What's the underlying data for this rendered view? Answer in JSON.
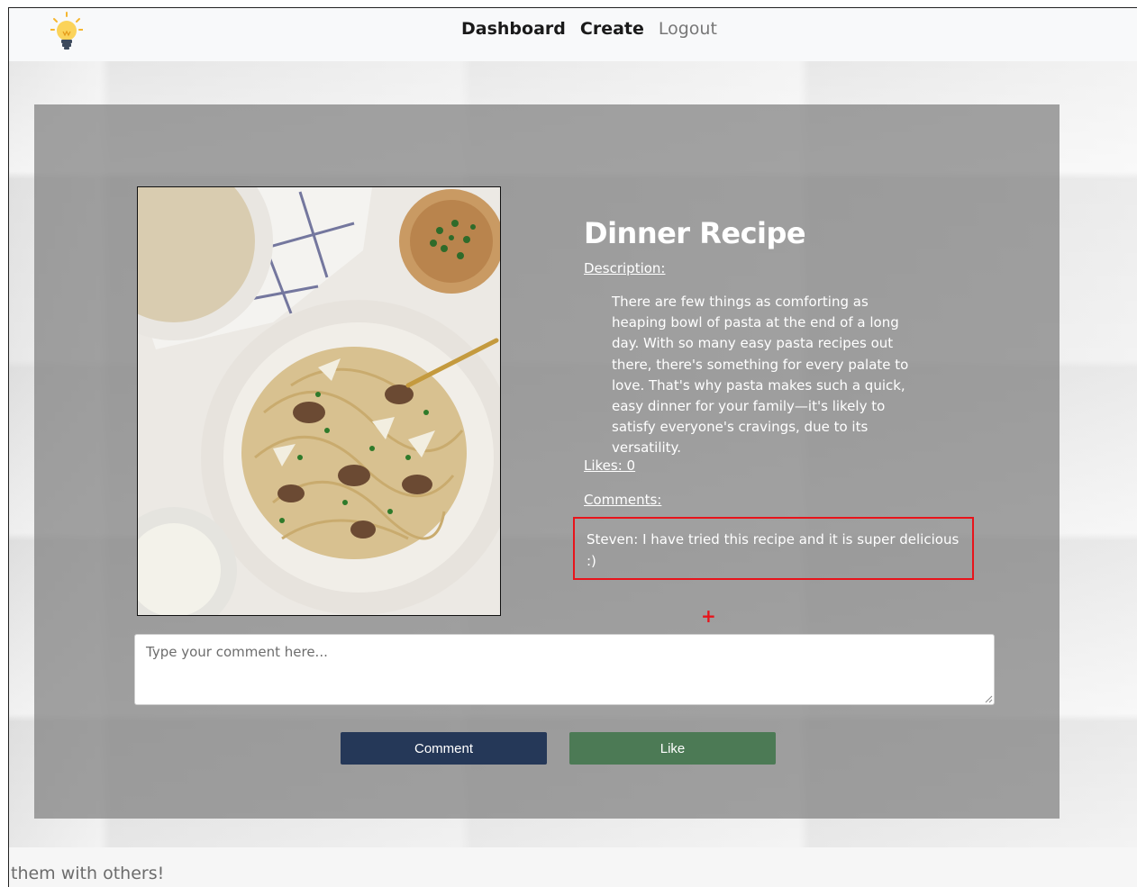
{
  "navbar": {
    "logo_icon": "lightbulb-icon",
    "links": [
      "Dashboard",
      "Create",
      "Logout"
    ]
  },
  "recipe": {
    "title": "Dinner Recipe",
    "description_label": "Description:",
    "description": "There are few things as comforting as heaping bowl of pasta at the end of a long day. With so many easy pasta recipes out there, there's something for every palate to love. That's why pasta makes such a quick, easy dinner for your family—it's likely to satisfy everyone's cravings, due to its versatility.",
    "likes_label": "Likes: 0",
    "comments_label": "Comments:",
    "comments": [
      {
        "text": "Steven: I have tried this recipe and it is super delicious :)"
      }
    ],
    "image_icon": "pasta-dish-image"
  },
  "form": {
    "placeholder": "Type your comment here...",
    "comment_button": "Comment",
    "like_button": "Like"
  },
  "annotation": {
    "plus": "+"
  },
  "footer": {
    "text": "them with others!"
  },
  "colors": {
    "comment_button": "#253858",
    "like_button": "#4c7a55",
    "highlight": "#e8141b"
  }
}
